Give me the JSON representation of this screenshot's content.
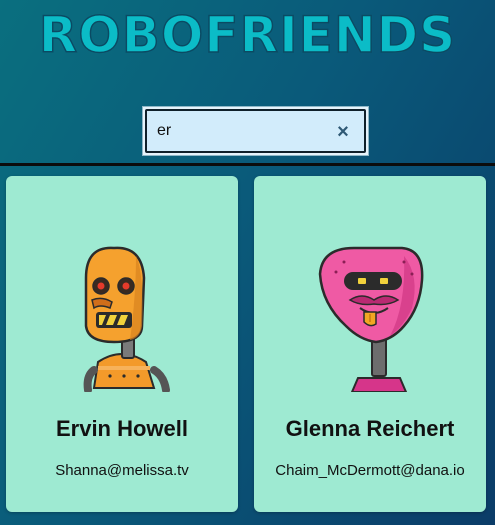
{
  "app": {
    "title": "ROBOFRIENDS"
  },
  "search": {
    "value": "er",
    "clear_icon": "close-icon",
    "clear_glyph": "×"
  },
  "colors": {
    "title": "#0bbcc7",
    "card_background": "#9eead2",
    "background_start": "#0a6f7f",
    "background_end": "#0b3c68"
  },
  "cards": [
    {
      "name": "Ervin Howell",
      "email": "Shanna@melissa.tv",
      "avatar": "orange-robot-image"
    },
    {
      "name": "Glenna Reichert",
      "email": "Chaim_McDermott@dana.io",
      "avatar": "pink-robot-image"
    }
  ]
}
